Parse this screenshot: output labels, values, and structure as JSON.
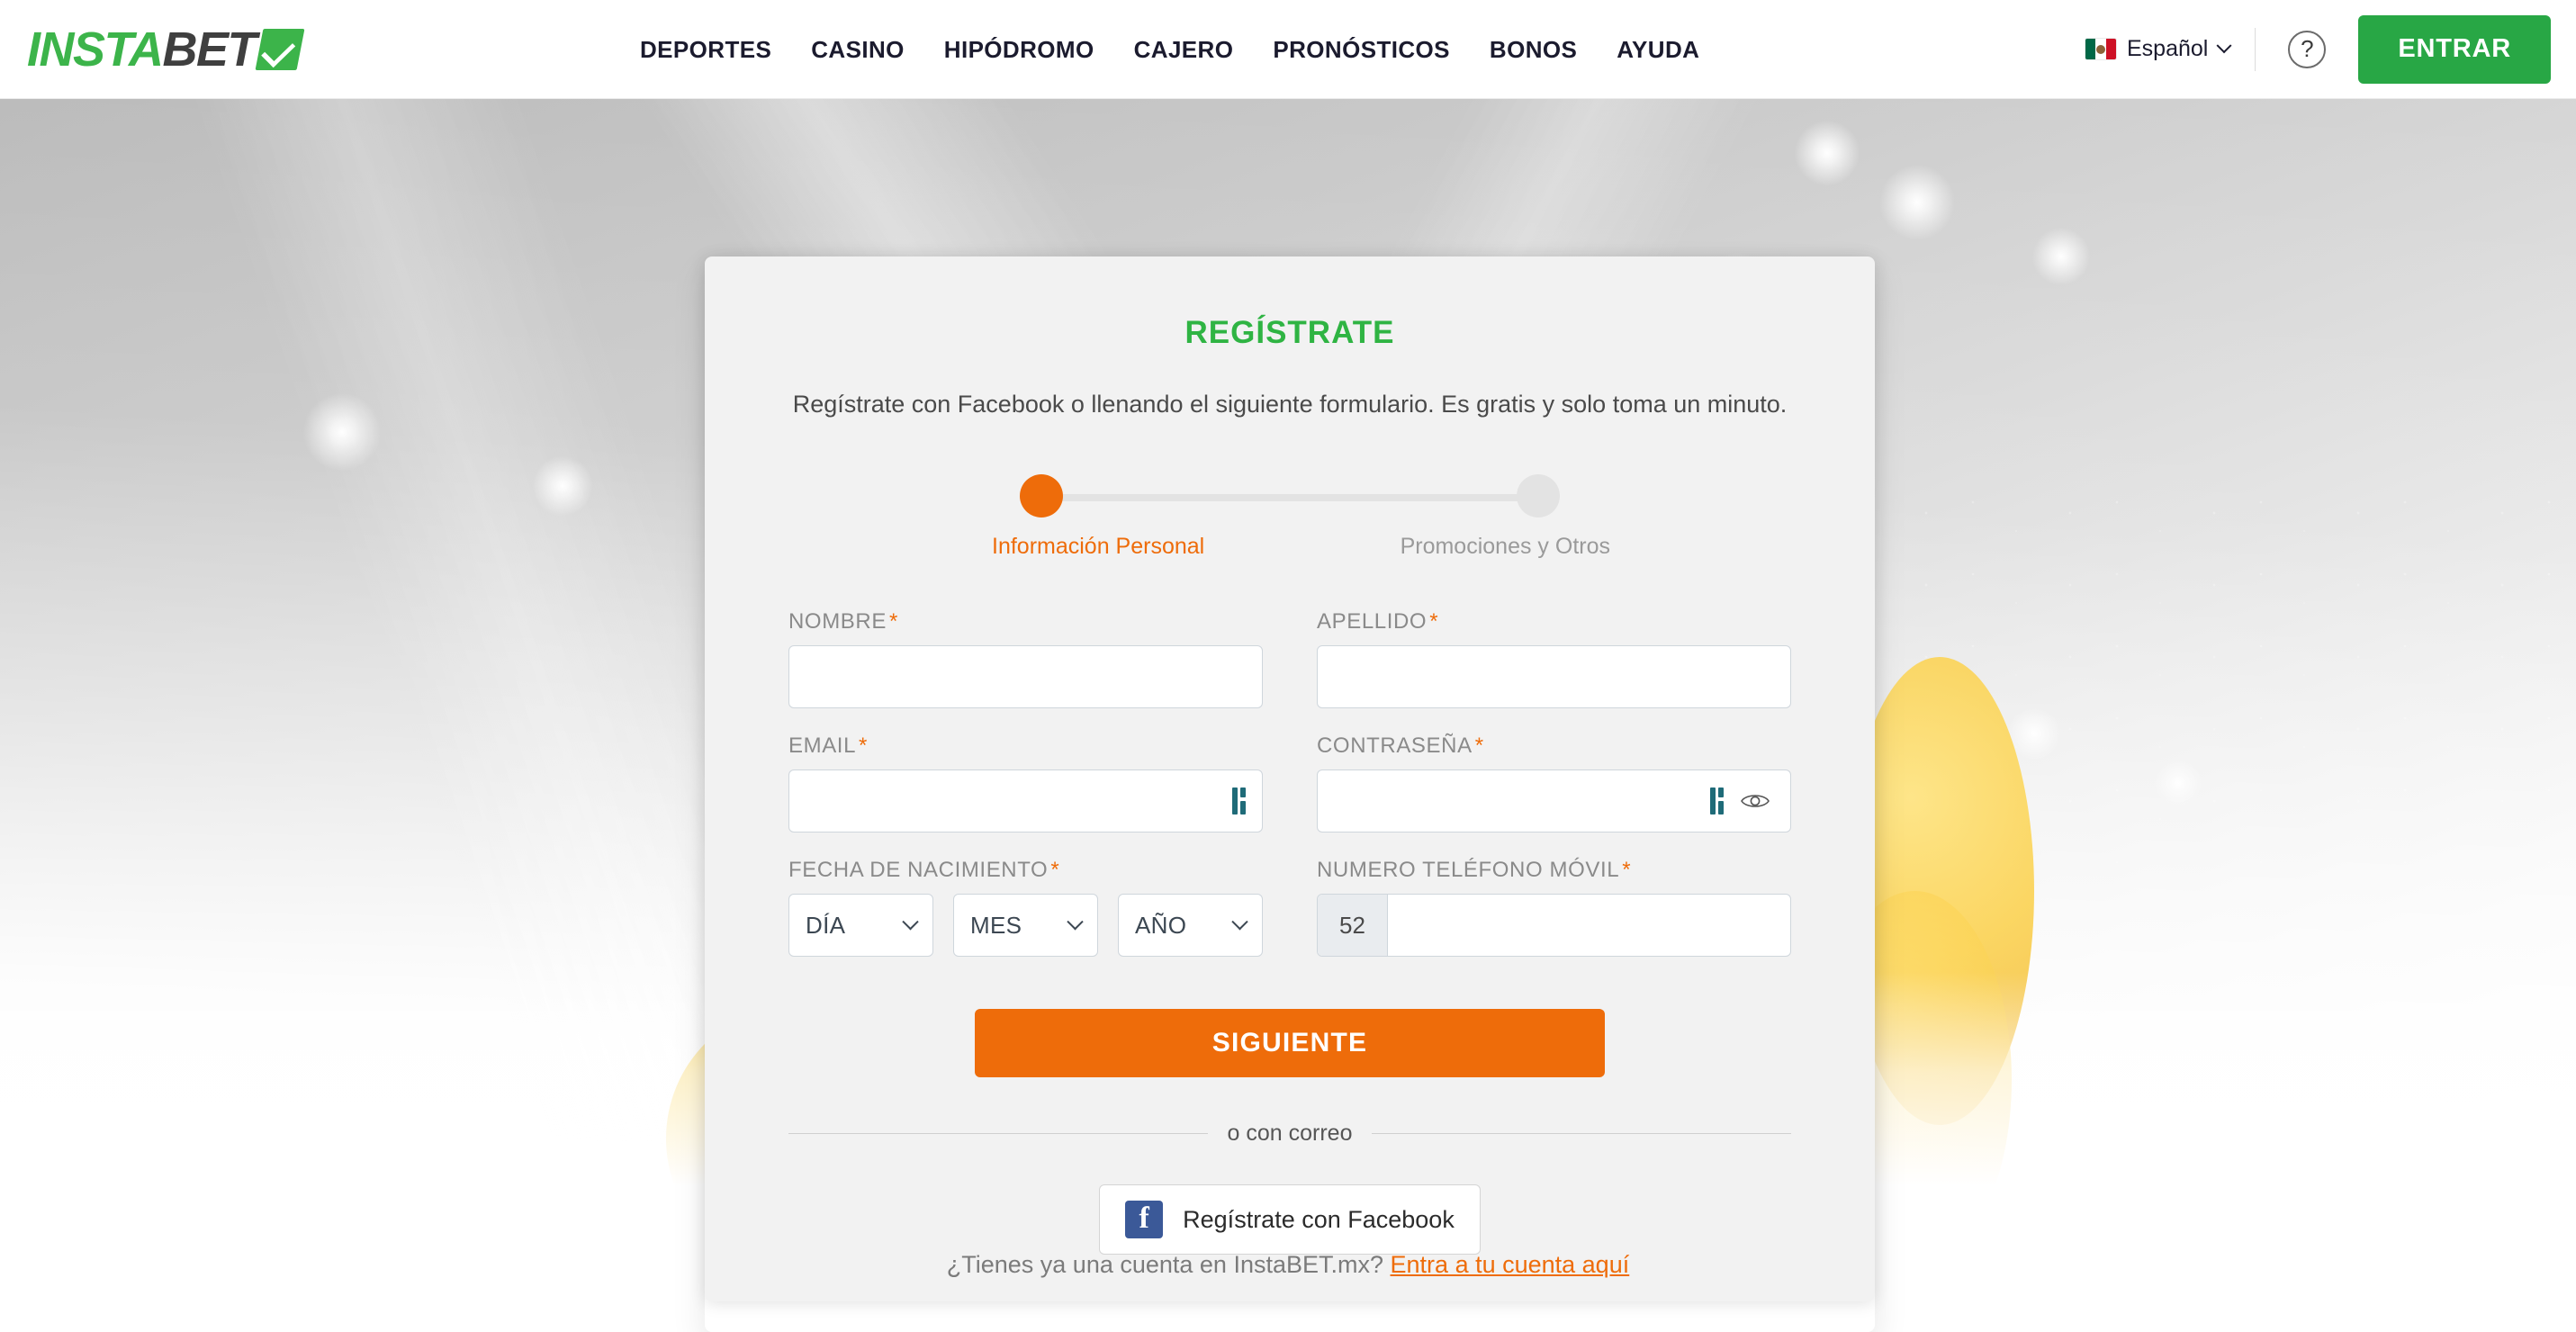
{
  "header": {
    "logo": {
      "part1": "INSTA",
      "part2": "BET",
      "check_icon": "check-icon"
    },
    "nav": [
      {
        "label": "DEPORTES"
      },
      {
        "label": "CASINO"
      },
      {
        "label": "HIPÓDROMO"
      },
      {
        "label": "CAJERO"
      },
      {
        "label": "PRONÓSTICOS"
      },
      {
        "label": "BONOS"
      },
      {
        "label": "AYUDA"
      }
    ],
    "language": {
      "label": "Español",
      "flag_icon": "mexico-flag-icon",
      "chevron_icon": "chevron-down-icon"
    },
    "help": {
      "label": "?",
      "icon": "help-circle-icon"
    },
    "login_button": {
      "label": "ENTRAR"
    }
  },
  "card": {
    "title": "REGÍSTRATE",
    "subtitle": "Regístrate con Facebook o llenando el siguiente formulario. Es gratis y solo toma un minuto.",
    "stepper": {
      "step1_label": "Información Personal",
      "step2_label": "Promociones y Otros",
      "active_color": "#ee6c0a",
      "inactive_color": "#e3e3e3"
    },
    "fields": {
      "nombre": {
        "label": "NOMBRE",
        "required": "*",
        "value": "",
        "placeholder": ""
      },
      "apellido": {
        "label": "APELLIDO",
        "required": "*",
        "value": "",
        "placeholder": ""
      },
      "email": {
        "label": "EMAIL",
        "required": "*",
        "value": "",
        "placeholder": "",
        "icon": "password-manager-icon"
      },
      "contrasena": {
        "label": "CONTRASEÑA",
        "required": "*",
        "value": "",
        "placeholder": "",
        "icon": "password-manager-icon",
        "reveal_icon": "eye-icon"
      },
      "fecha_nacimiento": {
        "label": "FECHA DE NACIMIENTO",
        "required": "*",
        "day": "DÍA",
        "month": "MES",
        "year": "AÑO"
      },
      "telefono": {
        "label": "NUMERO TELÉFONO MÓVIL",
        "required": "*",
        "prefix": "52",
        "value": "",
        "placeholder": ""
      }
    },
    "submit_button": {
      "label": "SIGUIENTE"
    },
    "divider_text": "o con correo",
    "facebook_button": {
      "label": "Regístrate con Facebook",
      "icon": "facebook-icon",
      "brand_color": "#3b5998"
    }
  },
  "footer": {
    "text": "¿Tienes ya una cuenta en InstaBET.mx?",
    "link": "Entra a tu cuenta aquí"
  },
  "colors": {
    "brand_green": "#3cb44a",
    "accent_orange": "#ee6c0a",
    "login_green": "#28a745",
    "card_bg": "#f2f2f2"
  }
}
